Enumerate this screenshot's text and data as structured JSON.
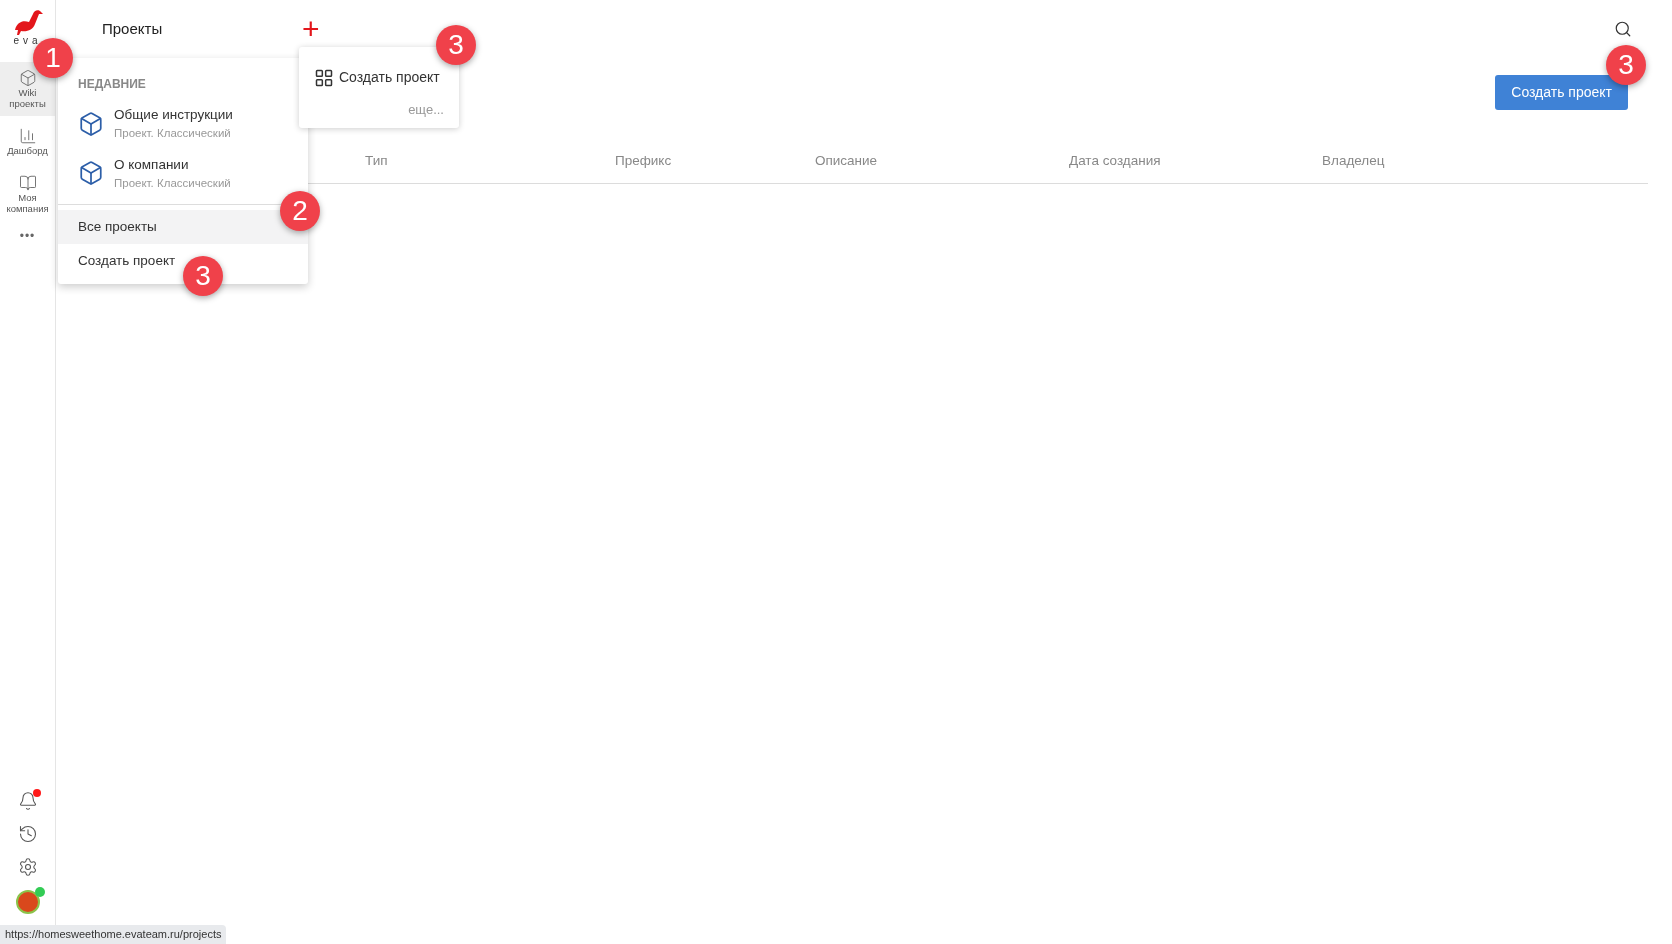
{
  "sidebar": {
    "logo_text": "eva",
    "items": [
      {
        "kind": "cube",
        "label": "Wiki проекты",
        "selected": true
      },
      {
        "kind": "chart",
        "label": "Дашборд",
        "selected": false
      },
      {
        "kind": "book",
        "label": "Моя компания",
        "selected": false
      }
    ],
    "more": "•••",
    "bottom": [
      {
        "kind": "bell",
        "badge": true
      },
      {
        "kind": "history",
        "badge": false
      },
      {
        "kind": "settings",
        "badge": false
      },
      {
        "kind": "avatar",
        "badge": true
      }
    ]
  },
  "header": {
    "title": "Проекты",
    "add": "+"
  },
  "menu": {
    "section": "НЕДАВНИЕ",
    "recent": [
      {
        "title": "Общие инструкции",
        "subtitle": "Проект. Классический"
      },
      {
        "title": "О компании",
        "subtitle": "Проект. Классический"
      }
    ],
    "actions": [
      {
        "label": "Все проекты",
        "selected": true
      },
      {
        "label": "Создать проект",
        "selected": false
      }
    ]
  },
  "popover": {
    "item": "Создать проект",
    "more": "еще..."
  },
  "create_button": "Создать проект",
  "table": {
    "columns": [
      "Тип",
      "Префикс",
      "Описание",
      "Дата создания",
      "Владелец"
    ]
  },
  "callouts": [
    "1",
    "2",
    "3",
    "3",
    "3"
  ],
  "status_url": "https://homesweethome.evateam.ru/projects"
}
